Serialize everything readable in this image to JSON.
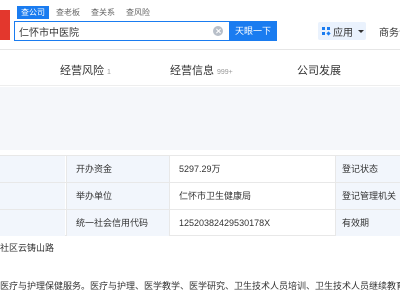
{
  "header": {
    "tabs": [
      {
        "label": "查公司",
        "active": true
      },
      {
        "label": "查老板",
        "active": false
      },
      {
        "label": "查关系",
        "active": false
      },
      {
        "label": "查风险",
        "active": false
      }
    ],
    "search": {
      "value": "仁怀市中医院"
    },
    "search_button": "天眼一下",
    "apps_label": "应用",
    "business_label": "商务合"
  },
  "subnav": {
    "items": [
      {
        "label": "经营风险",
        "count": "1"
      },
      {
        "label": "经营信息",
        "count": "999+"
      },
      {
        "label": "公司发展",
        "count": ""
      }
    ]
  },
  "info_table": {
    "rows": [
      {
        "label": "开办资金",
        "value": "5297.29万",
        "label2": "登记状态"
      },
      {
        "label": "举办单位",
        "value": "仁怀市卫生健康局",
        "label2": "登记管理机关"
      },
      {
        "label": "统一社会信用代码",
        "value": "12520382429530178X",
        "label2": "有效期"
      }
    ]
  },
  "address_fragment": "社区云铸山路",
  "scope_fragment": "医疗与护理保健服务。医疗与护理、医学教学、医学研究、卫生技术人员培训、卫生技术人员继续教育",
  "colors": {
    "brand_blue": "#1a7cf0",
    "logo_red": "#e3372d",
    "label_bg": "#f2f6fc"
  }
}
